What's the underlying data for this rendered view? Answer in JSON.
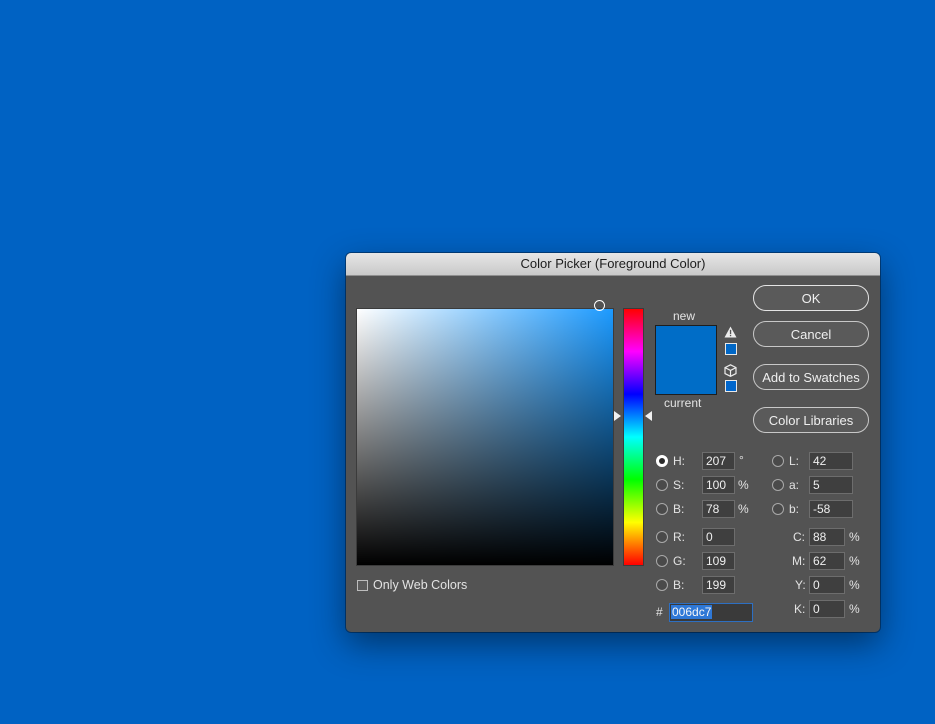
{
  "window": {
    "title": "Color Picker (Foreground Color)"
  },
  "buttons": {
    "ok": "OK",
    "cancel": "Cancel",
    "add_to_swatches": "Add to Swatches",
    "color_libraries": "Color Libraries"
  },
  "preview": {
    "new_label": "new",
    "current_label": "current",
    "new_color": "#006dc7",
    "current_color": "#006dc7",
    "gamut_warning_icon": "warning-triangle-icon",
    "web_safe_icon": "cube-icon",
    "gamut_swatch_color": "#0067c6",
    "web_safe_swatch_color": "#0066cc"
  },
  "hsb": {
    "h_label": "H:",
    "h_value": "207",
    "h_unit": "°",
    "s_label": "S:",
    "s_value": "100",
    "s_unit": "%",
    "b_label": "B:",
    "b_value": "78",
    "b_unit": "%",
    "selected_mode": "H"
  },
  "rgb": {
    "r_label": "R:",
    "r_value": "0",
    "g_label": "G:",
    "g_value": "109",
    "b_label": "B:",
    "b_value": "199"
  },
  "lab": {
    "l_label": "L:",
    "l_value": "42",
    "a_label": "a:",
    "a_value": "5",
    "b_label": "b:",
    "b_value": "-58"
  },
  "cmyk": {
    "c_label": "C:",
    "c_value": "88",
    "m_label": "M:",
    "m_value": "62",
    "y_label": "Y:",
    "y_value": "0",
    "k_label": "K:",
    "k_value": "0",
    "unit": "%"
  },
  "hex": {
    "label": "#",
    "value": "006dc7"
  },
  "options": {
    "only_web_colors_label": "Only Web Colors",
    "only_web_colors_checked": false
  },
  "colors": {
    "canvas_background": "#0062c3",
    "hue_pure": "#1c9aff"
  }
}
